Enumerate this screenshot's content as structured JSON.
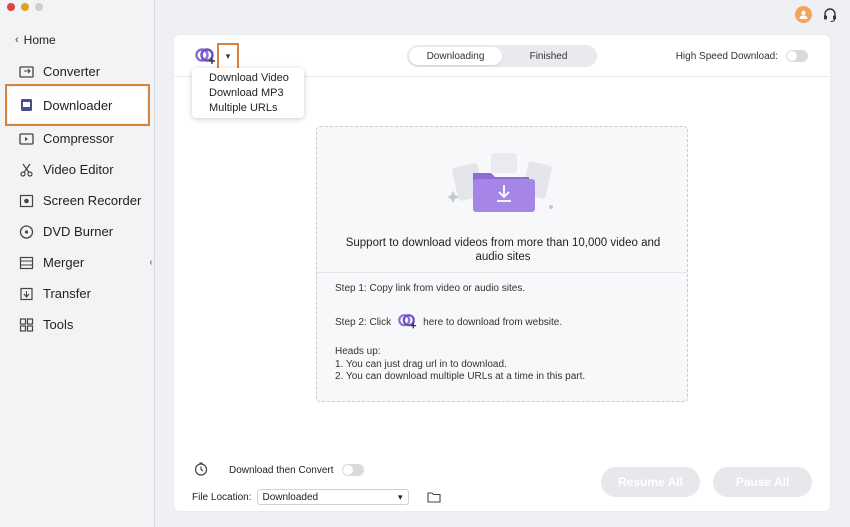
{
  "sidebar": {
    "home_label": "Home",
    "items": [
      {
        "label": "Converter",
        "icon": "converter-icon"
      },
      {
        "label": "Downloader",
        "icon": "downloader-icon",
        "active": true
      },
      {
        "label": "Compressor",
        "icon": "compressor-icon"
      },
      {
        "label": "Video Editor",
        "icon": "scissors-icon"
      },
      {
        "label": "Screen Recorder",
        "icon": "screen-recorder-icon"
      },
      {
        "label": "DVD Burner",
        "icon": "dvd-icon"
      },
      {
        "label": "Merger",
        "icon": "merger-icon"
      },
      {
        "label": "Transfer",
        "icon": "transfer-icon"
      },
      {
        "label": "Tools",
        "icon": "tools-icon"
      }
    ]
  },
  "header": {
    "tabs": [
      "Downloading",
      "Finished"
    ],
    "active_tab": "Downloading",
    "high_speed_label": "High Speed Download:",
    "high_speed_enabled": false
  },
  "add_menu": {
    "items": [
      "Download Video",
      "Download MP3",
      "Multiple URLs"
    ]
  },
  "dropzone": {
    "message": "Support to download videos from more than 10,000 video and audio sites",
    "step1": "Step 1: Copy link from video or audio sites.",
    "step2_prefix": "Step 2: Click",
    "step2_suffix": "here to download from website.",
    "heads_up_title": "Heads up:",
    "tip1": "1. You can just drag url in to download.",
    "tip2": "2. You can download multiple URLs at a time in this part."
  },
  "footer": {
    "download_then_convert": "Download then Convert",
    "file_location_label": "File Location:",
    "file_location_value": "Downloaded",
    "resume_all": "Resume All",
    "pause_all": "Pause All"
  },
  "colors": {
    "accent_purple": "#8e6bd6",
    "highlight_orange": "#d6833e",
    "avatar_orange": "#f4a35b"
  }
}
